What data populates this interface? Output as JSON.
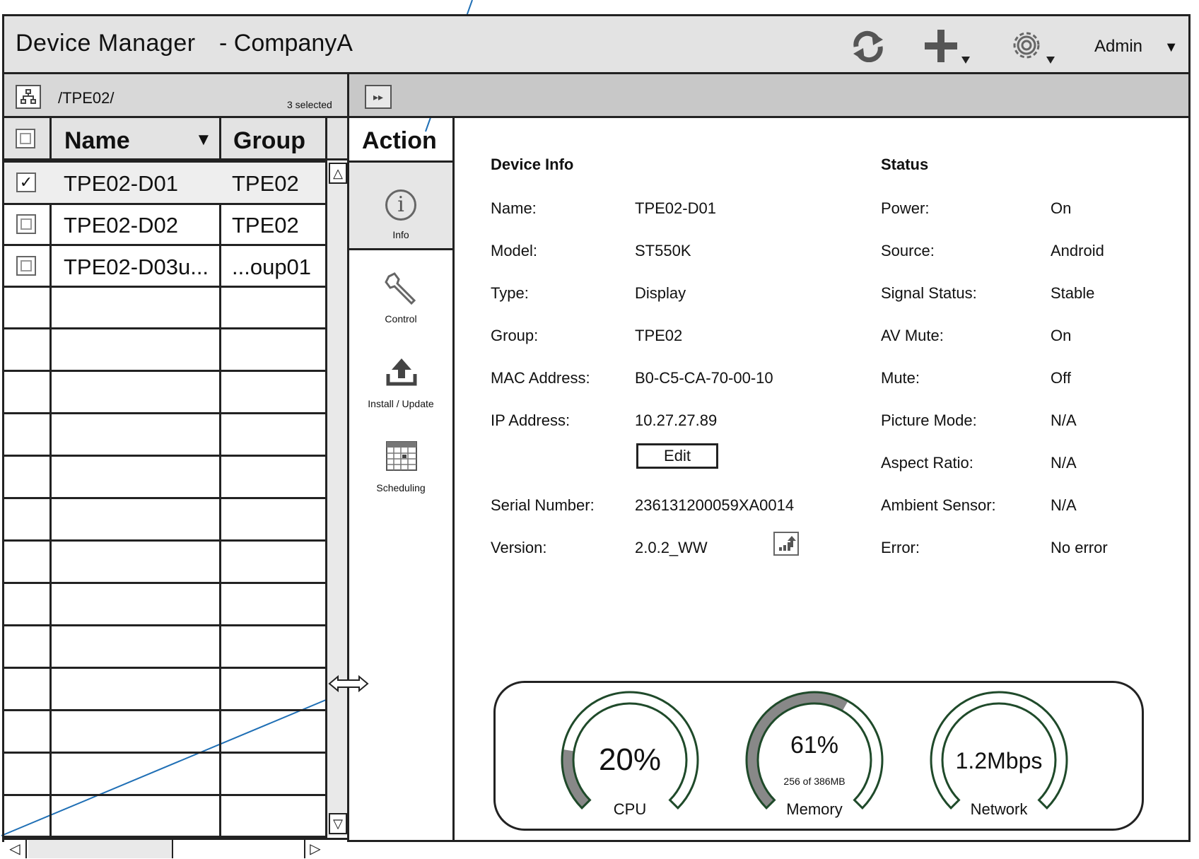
{
  "window": {
    "title": "Device Manager",
    "company": "- CompanyA",
    "user": "Admin",
    "icons": [
      "refresh-icon",
      "add-icon",
      "settings-icon",
      "dropdown-caret-icon"
    ]
  },
  "pathbar": {
    "path": "/TPE02/",
    "selected": "3 selected"
  },
  "table": {
    "headers": {
      "name": "Name",
      "group": "Group"
    },
    "rows": [
      {
        "checked": true,
        "name": "TPE02-D01",
        "group": "TPE02"
      },
      {
        "checked": false,
        "name": "TPE02-D02",
        "group": "TPE02"
      },
      {
        "checked": false,
        "name": "TPE02-D03u...",
        "group": "...oup01"
      }
    ]
  },
  "action": {
    "header": "Action",
    "items": [
      {
        "label": "Info",
        "icon": "info-icon"
      },
      {
        "label": "Control",
        "icon": "wrench-icon"
      },
      {
        "label": "Install / Update",
        "icon": "upload-icon"
      },
      {
        "label": "Scheduling",
        "icon": "calendar-icon"
      }
    ]
  },
  "device_info": {
    "title": "Device Info",
    "fields": [
      {
        "label": "Name:",
        "value": "TPE02-D01"
      },
      {
        "label": "Model:",
        "value": "ST550K"
      },
      {
        "label": "Type:",
        "value": "Display"
      },
      {
        "label": "Group:",
        "value": "TPE02"
      },
      {
        "label": "MAC Address:",
        "value": "B0-C5-CA-70-00-10"
      },
      {
        "label": "IP Address:",
        "value": "10.27.27.89"
      },
      {
        "label": "Serial Number:",
        "value": "236131200059XA0014"
      },
      {
        "label": "Version:",
        "value": "2.0.2_WW"
      }
    ],
    "edit_label": "Edit"
  },
  "status": {
    "title": "Status",
    "fields": [
      {
        "label": "Power:",
        "value": "On"
      },
      {
        "label": "Source:",
        "value": "Android"
      },
      {
        "label": "Signal Status:",
        "value": "Stable"
      },
      {
        "label": "AV Mute:",
        "value": "On"
      },
      {
        "label": "Mute:",
        "value": "Off"
      },
      {
        "label": "Picture Mode:",
        "value": "N/A"
      },
      {
        "label": "Aspect Ratio:",
        "value": "N/A"
      },
      {
        "label": "Ambient Sensor:",
        "value": "N/A"
      },
      {
        "label": "Error:",
        "value": "No error"
      }
    ]
  },
  "metrics": {
    "cpu": {
      "value": "20%",
      "label": "CPU",
      "fraction": 0.2
    },
    "memory": {
      "value": "61%",
      "label": "Memory",
      "sub": "256 of 386MB",
      "fraction": 0.61
    },
    "network": {
      "value": "1.2Mbps",
      "label": "Network",
      "fraction": 0.0
    }
  },
  "colors": {
    "accent_line": "#1f6fb5",
    "gauge_ring": "#1f4a2a",
    "gauge_fill": "#888888"
  }
}
